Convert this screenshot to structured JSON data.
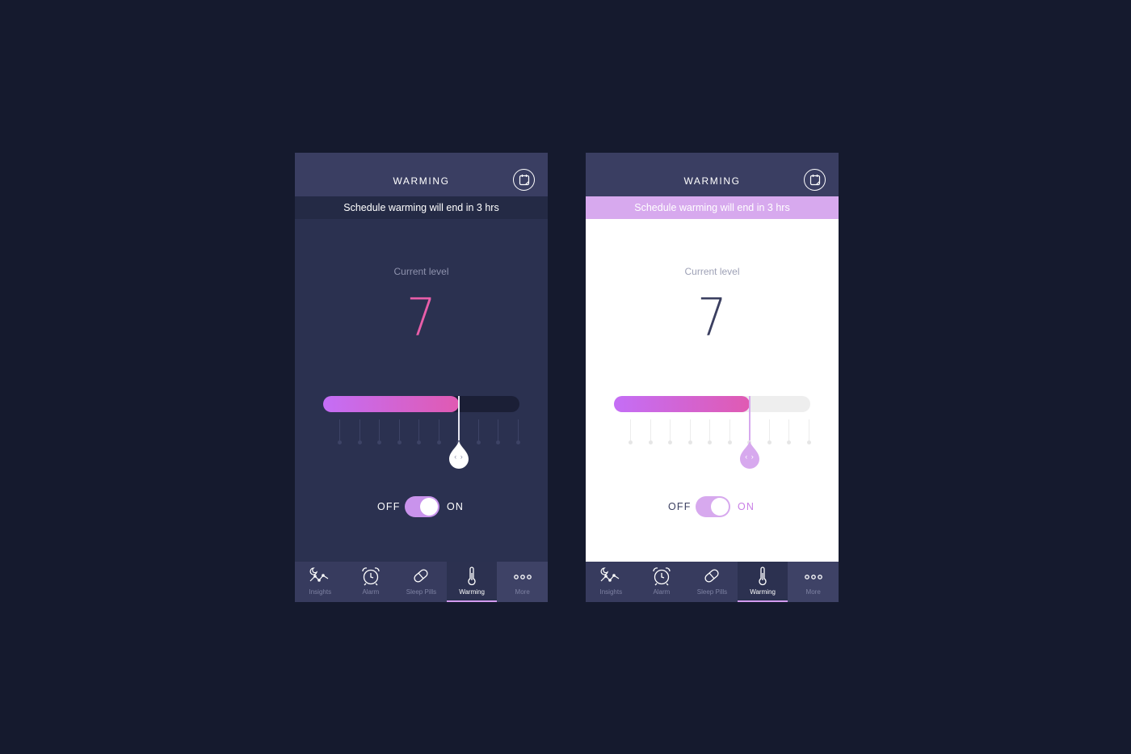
{
  "screens": [
    {
      "theme": "dark",
      "header": {
        "title": "WARMING",
        "calendar_icon": "calendar-icon"
      },
      "banner": {
        "text": "Schedule warming will end in 3 hrs"
      },
      "level": {
        "label": "Current level",
        "value": "7"
      },
      "slider": {
        "fraction": 0.69
      },
      "toggle": {
        "off_label": "OFF",
        "on_label": "ON",
        "state": "on"
      },
      "tabs": [
        {
          "label": "Insights",
          "icon": "insights-icon"
        },
        {
          "label": "Alarm",
          "icon": "alarm-clock-icon"
        },
        {
          "label": "Sleep Pills",
          "icon": "pill-icon"
        },
        {
          "label": "Warming",
          "icon": "thermometer-icon",
          "active": true
        },
        {
          "label": "More",
          "icon": "more-dots-icon"
        }
      ]
    },
    {
      "theme": "light",
      "header": {
        "title": "WARMING",
        "calendar_icon": "calendar-icon"
      },
      "banner": {
        "text": "Schedule warming will end in 3 hrs"
      },
      "level": {
        "label": "Current level",
        "value": "7"
      },
      "slider": {
        "fraction": 0.69
      },
      "toggle": {
        "off_label": "OFF",
        "on_label": "ON",
        "state": "on"
      },
      "tabs": [
        {
          "label": "Insights",
          "icon": "insights-icon"
        },
        {
          "label": "Alarm",
          "icon": "alarm-clock-icon"
        },
        {
          "label": "Sleep Pills",
          "icon": "pill-icon"
        },
        {
          "label": "Warming",
          "icon": "thermometer-icon",
          "active": true
        },
        {
          "label": "More",
          "icon": "more-dots-icon"
        }
      ]
    }
  ],
  "colors": {
    "background": "#151a2e",
    "accent_gradient_start": "#c46ef6",
    "accent_gradient_end": "#e05ab2",
    "dark_level_value": "#e85ea9",
    "light_banner": "#d7a9ee"
  }
}
